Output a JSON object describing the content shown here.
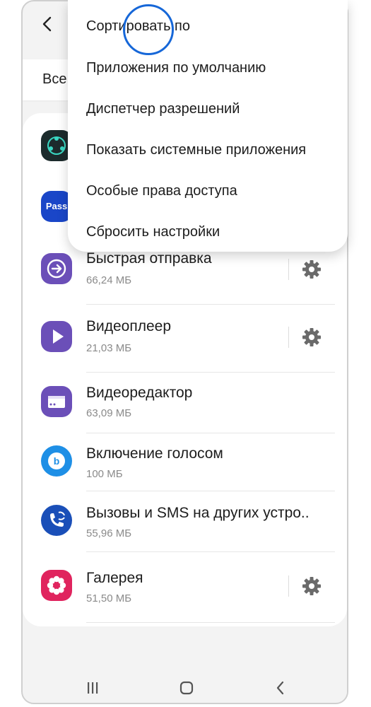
{
  "header": {
    "partial_title": ""
  },
  "filter": {
    "label": "Все"
  },
  "apps": [
    {
      "name": "",
      "size": "",
      "icon": "app-round-icon",
      "has_settings": false
    },
    {
      "name": "",
      "size": "",
      "icon": "pass-icon",
      "icon_text": "Pass",
      "has_settings": false
    },
    {
      "name": "Быстрая отправка",
      "size": "66,24 МБ",
      "icon": "quick-share-icon",
      "has_settings": true
    },
    {
      "name": "Видеоплеер",
      "size": "21,03 МБ",
      "icon": "video-player-icon",
      "has_settings": true
    },
    {
      "name": "Видеоредактор",
      "size": "63,09 МБ",
      "icon": "video-editor-icon",
      "has_settings": false
    },
    {
      "name": "Включение голосом",
      "size": "100 МБ",
      "icon": "bixby-voice-icon",
      "has_settings": false
    },
    {
      "name": "Вызовы и SMS на других устро..",
      "size": "55,96 МБ",
      "icon": "call-sms-other-devices-icon",
      "has_settings": false
    },
    {
      "name": "Галерея",
      "size": "51,50 МБ",
      "icon": "gallery-icon",
      "has_settings": true
    }
  ],
  "menu": {
    "items": [
      "Сортировать по",
      "Приложения по умолчанию",
      "Диспетчер разрешений",
      "Показать системные приложения",
      "Особые права доступа",
      "Сбросить настройки"
    ]
  },
  "colors": {
    "accent_ring": "#1667d8",
    "purple_icon": "#6b4fb8",
    "pass_blue": "#1a46c8",
    "gallery_red": "#e0245e",
    "bixby_blue": "#1e8fe6"
  },
  "navbar": {
    "icons": [
      "recents-icon",
      "home-icon",
      "back-icon"
    ]
  }
}
